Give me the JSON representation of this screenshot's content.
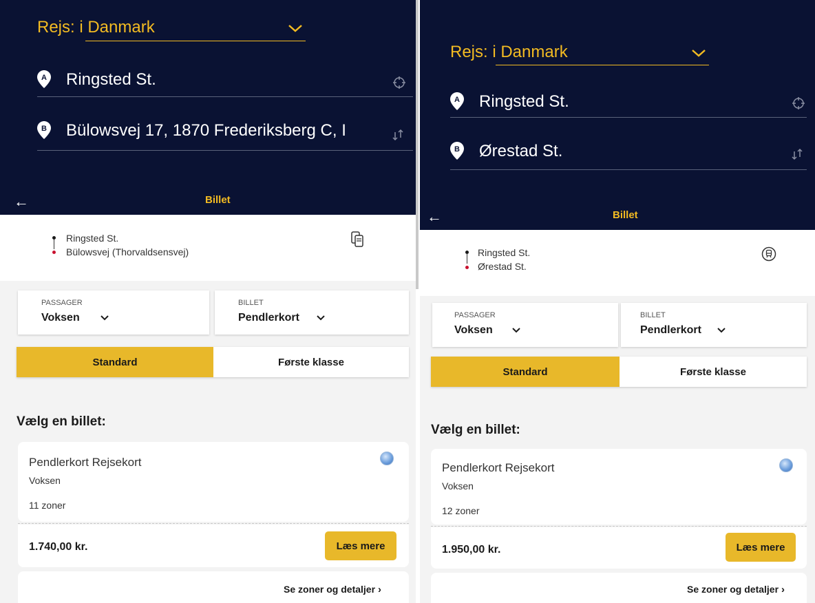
{
  "left": {
    "trip_select": "Rejs: i Danmark",
    "from": "Ringsted St.",
    "to": "Bülowsvej 17, 1870 Frederiksberg C, I",
    "header_title": "Billet",
    "route_from": "Ringsted St.",
    "route_to": "Bülowsvej (Thorvaldsensvej)",
    "passenger_label": "PASSAGER",
    "passenger_value": "Voksen",
    "ticket_label": "BILLET",
    "ticket_value": "Pendlerkort",
    "class_standard": "Standard",
    "class_first": "Første klasse",
    "choose_heading": "Vælg en billet:",
    "card_title": "Pendlerkort Rejsekort",
    "card_sub": "Voksen",
    "card_zones": "11 zoner",
    "price": "1.740,00 kr.",
    "read_more": "Læs mere",
    "zones_link": "Se zoner og detaljer"
  },
  "right": {
    "trip_select": "Rejs: i Danmark",
    "from": "Ringsted St.",
    "to": "Ørestad St.",
    "header_title": "Billet",
    "route_from": "Ringsted St.",
    "route_to": "Ørestad St.",
    "passenger_label": "PASSAGER",
    "passenger_value": "Voksen",
    "ticket_label": "BILLET",
    "ticket_value": "Pendlerkort",
    "class_standard": "Standard",
    "class_first": "Første klasse",
    "choose_heading": "Vælg en billet:",
    "card_title": "Pendlerkort Rejsekort",
    "card_sub": "Voksen",
    "card_zones": "12 zoner",
    "price": "1.950,00 kr.",
    "read_more": "Læs mere",
    "zones_link": "Se zoner og detaljer"
  },
  "colors": {
    "header_bg": "#0a1233",
    "accent": "#f3bb22",
    "button": "#e8b82a",
    "dest_dot": "#c8102e"
  },
  "icons": {
    "pin_a": "map-pin-a-icon",
    "pin_b": "map-pin-b-icon",
    "locate": "crosshair-icon",
    "swap": "swap-arrows-icon",
    "back": "arrow-left-icon",
    "chevron": "chevron-down-icon",
    "card": "card-icon",
    "transport": "train-icon"
  }
}
